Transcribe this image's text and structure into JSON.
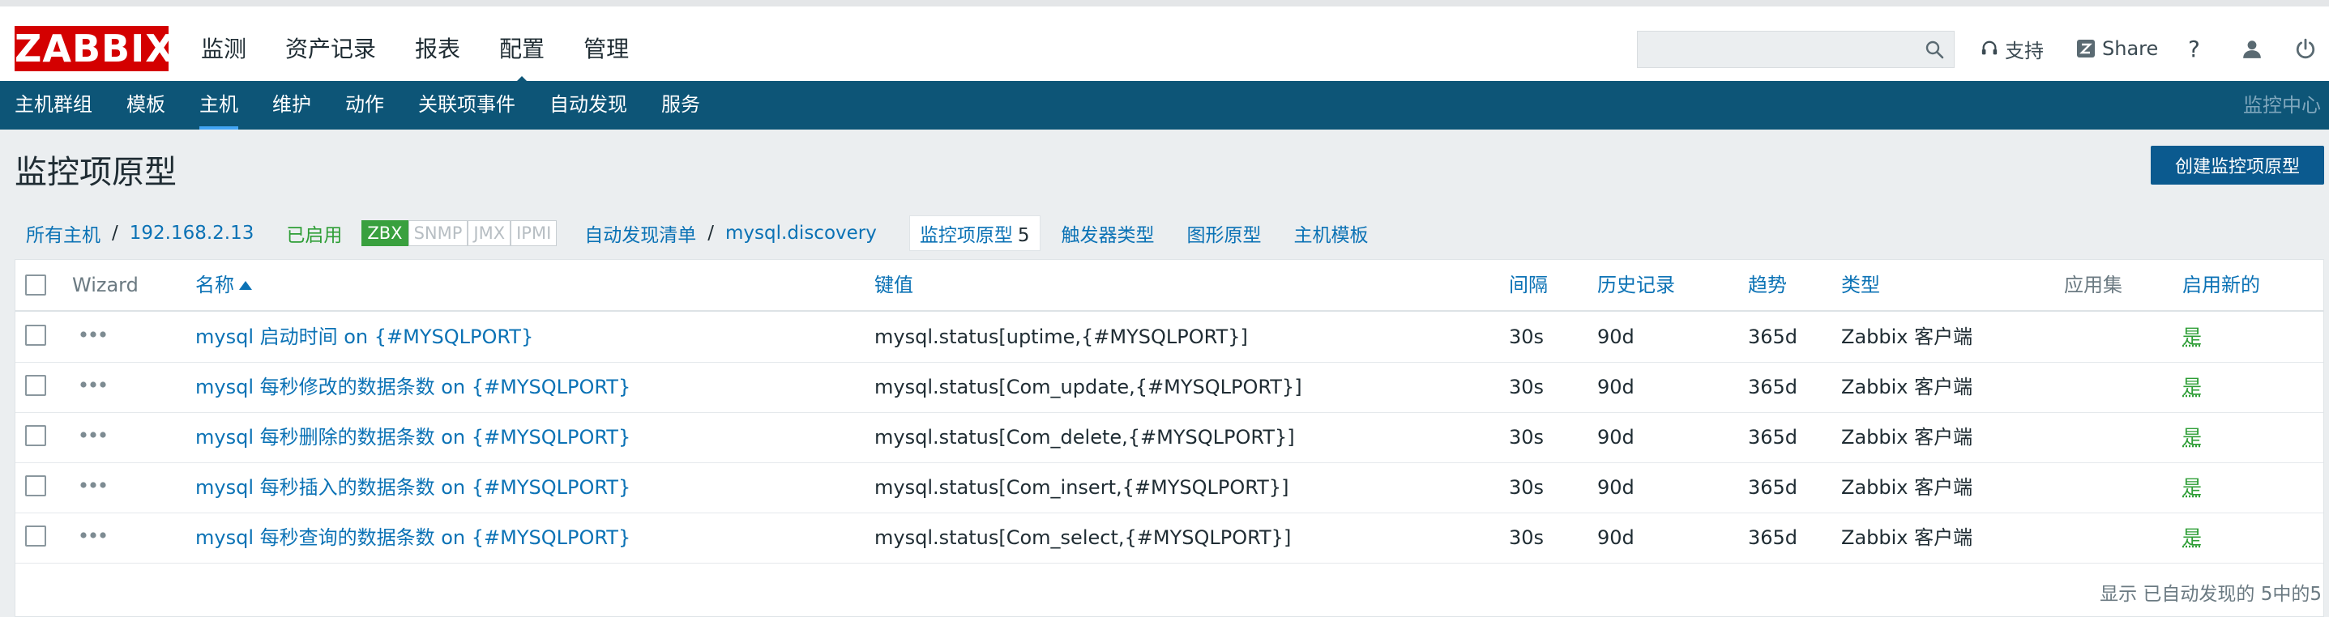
{
  "logo": "ZABBIX",
  "main_menu": [
    "监测",
    "资产记录",
    "报表",
    "配置",
    "管理"
  ],
  "main_menu_active": "配置",
  "search": {
    "placeholder": "",
    "value": ""
  },
  "tools": {
    "support": "支持",
    "share": "Share",
    "help": "?"
  },
  "sub_menu": [
    "主机群组",
    "模板",
    "主机",
    "维护",
    "动作",
    "关联项事件",
    "自动发现",
    "服务"
  ],
  "sub_menu_active": "主机",
  "sub_menu_right": "监控中心",
  "page_title": "监控项原型",
  "create_button": "创建监控项原型",
  "breadcrumb": {
    "all_hosts": "所有主机",
    "sep1": "/",
    "host": "192.168.2.13",
    "status": "已启用",
    "badges": [
      {
        "label": "ZBX",
        "active": true
      },
      {
        "label": "SNMP",
        "active": false
      },
      {
        "label": "JMX",
        "active": false
      },
      {
        "label": "IPMI",
        "active": false
      }
    ],
    "discovery_list": "自动发现清单",
    "sep2": "/",
    "discovery_rule": "mysql.discovery",
    "item_prototypes": "监控项原型",
    "item_prototypes_count": "5",
    "trigger_prototypes": "触发器类型",
    "graph_prototypes": "图形原型",
    "host_templates": "主机模板"
  },
  "table": {
    "headers": {
      "wizard": "Wizard",
      "name": "名称",
      "key": "键值",
      "interval": "间隔",
      "history": "历史记录",
      "trends": "趋势",
      "type": "类型",
      "applications": "应用集",
      "create_enabled": "启用新的"
    },
    "rows": [
      {
        "name": "mysql 启动时间 on {#MYSQLPORT}",
        "key": "mysql.status[uptime,{#MYSQLPORT}]",
        "interval": "30s",
        "history": "90d",
        "trends": "365d",
        "type": "Zabbix 客户端",
        "enabled": "是"
      },
      {
        "name": "mysql 每秒修改的数据条数 on {#MYSQLPORT}",
        "key": "mysql.status[Com_update,{#MYSQLPORT}]",
        "interval": "30s",
        "history": "90d",
        "trends": "365d",
        "type": "Zabbix 客户端",
        "enabled": "是"
      },
      {
        "name": "mysql 每秒删除的数据条数 on {#MYSQLPORT}",
        "key": "mysql.status[Com_delete,{#MYSQLPORT}]",
        "interval": "30s",
        "history": "90d",
        "trends": "365d",
        "type": "Zabbix 客户端",
        "enabled": "是"
      },
      {
        "name": "mysql 每秒插入的数据条数 on {#MYSQLPORT}",
        "key": "mysql.status[Com_insert,{#MYSQLPORT}]",
        "interval": "30s",
        "history": "90d",
        "trends": "365d",
        "type": "Zabbix 客户端",
        "enabled": "是"
      },
      {
        "name": "mysql 每秒查询的数据条数 on {#MYSQLPORT}",
        "key": "mysql.status[Com_select,{#MYSQLPORT}]",
        "interval": "30s",
        "history": "90d",
        "trends": "365d",
        "type": "Zabbix 客户端",
        "enabled": "是"
      }
    ],
    "footer": "显示 已自动发现的 5中的5"
  },
  "colors": {
    "logo_bg": "#d40000",
    "subnav_bg": "#0d5577",
    "link": "#0b72b5",
    "enabled_green": "#2e9e36",
    "primary_button": "#0b5a8f"
  },
  "icons": [
    "search-icon",
    "headset-icon",
    "share-icon",
    "help-icon",
    "user-icon",
    "power-icon",
    "dots-icon",
    "sort-asc-icon"
  ]
}
